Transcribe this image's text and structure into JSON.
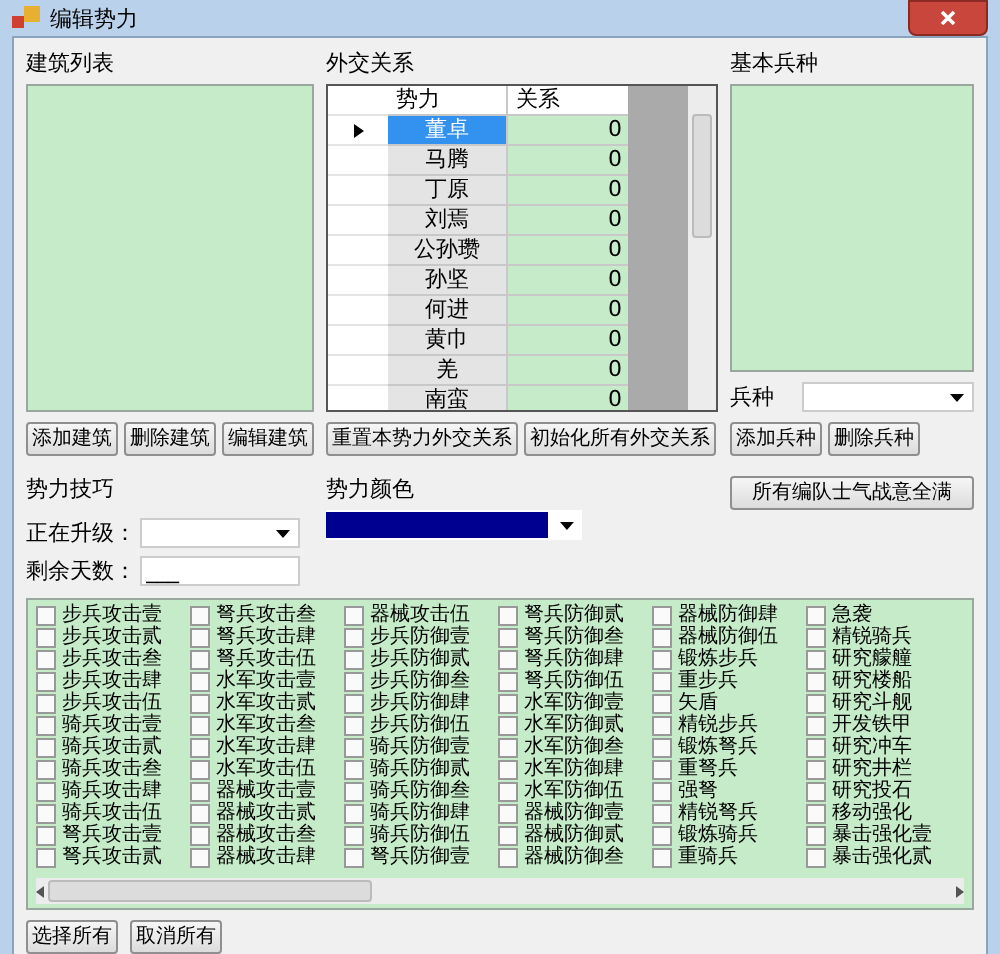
{
  "window": {
    "title": "编辑势力"
  },
  "buildings": {
    "label": "建筑列表",
    "buttons": [
      "添加建筑",
      "删除建筑",
      "编辑建筑"
    ]
  },
  "diplomacy": {
    "label": "外交关系",
    "columns": [
      "势力",
      "关系"
    ],
    "rows": [
      {
        "faction": "董卓",
        "relation": "0",
        "selected": true
      },
      {
        "faction": "马腾",
        "relation": "0",
        "selected": false
      },
      {
        "faction": "丁原",
        "relation": "0",
        "selected": false
      },
      {
        "faction": "刘焉",
        "relation": "0",
        "selected": false
      },
      {
        "faction": "公孙瓒",
        "relation": "0",
        "selected": false
      },
      {
        "faction": "孙坚",
        "relation": "0",
        "selected": false
      },
      {
        "faction": "何进",
        "relation": "0",
        "selected": false
      },
      {
        "faction": "黄巾",
        "relation": "0",
        "selected": false
      },
      {
        "faction": "羌",
        "relation": "0",
        "selected": false
      },
      {
        "faction": "南蛮",
        "relation": "0",
        "selected": false
      }
    ],
    "buttons": [
      "重置本势力外交关系",
      "初始化所有外交关系"
    ]
  },
  "troops": {
    "label": "基本兵种",
    "type_label": "兵种",
    "buttons": [
      "添加兵种",
      "删除兵种"
    ]
  },
  "skills": {
    "label": "势力技巧",
    "upgrading_label": "正在升级：",
    "days_label": "剩余天数：",
    "days_value": "___"
  },
  "faction_color": {
    "label": "势力颜色",
    "color": "#000090"
  },
  "morale_button": "所有编队士气战意全满",
  "techs": [
    {
      "label": "步兵攻击壹",
      "checked": false
    },
    {
      "label": "步兵攻击贰",
      "checked": false
    },
    {
      "label": "步兵攻击叁",
      "checked": false
    },
    {
      "label": "步兵攻击肆",
      "checked": false
    },
    {
      "label": "步兵攻击伍",
      "checked": false
    },
    {
      "label": "骑兵攻击壹",
      "checked": false
    },
    {
      "label": "骑兵攻击贰",
      "checked": false
    },
    {
      "label": "骑兵攻击叁",
      "checked": false
    },
    {
      "label": "骑兵攻击肆",
      "checked": false
    },
    {
      "label": "骑兵攻击伍",
      "checked": false
    },
    {
      "label": "弩兵攻击壹",
      "checked": false
    },
    {
      "label": "弩兵攻击贰",
      "checked": false
    },
    {
      "label": "弩兵攻击叁",
      "checked": false
    },
    {
      "label": "弩兵攻击肆",
      "checked": false
    },
    {
      "label": "弩兵攻击伍",
      "checked": false
    },
    {
      "label": "水军攻击壹",
      "checked": false
    },
    {
      "label": "水军攻击贰",
      "checked": false
    },
    {
      "label": "水军攻击叁",
      "checked": false
    },
    {
      "label": "水军攻击肆",
      "checked": false
    },
    {
      "label": "水军攻击伍",
      "checked": false
    },
    {
      "label": "器械攻击壹",
      "checked": false
    },
    {
      "label": "器械攻击贰",
      "checked": false
    },
    {
      "label": "器械攻击叁",
      "checked": false
    },
    {
      "label": "器械攻击肆",
      "checked": false
    },
    {
      "label": "器械攻击伍",
      "checked": false
    },
    {
      "label": "步兵防御壹",
      "checked": false
    },
    {
      "label": "步兵防御贰",
      "checked": false
    },
    {
      "label": "步兵防御叁",
      "checked": false
    },
    {
      "label": "步兵防御肆",
      "checked": false
    },
    {
      "label": "步兵防御伍",
      "checked": false
    },
    {
      "label": "骑兵防御壹",
      "checked": false
    },
    {
      "label": "骑兵防御贰",
      "checked": false
    },
    {
      "label": "骑兵防御叁",
      "checked": false
    },
    {
      "label": "骑兵防御肆",
      "checked": false
    },
    {
      "label": "骑兵防御伍",
      "checked": false
    },
    {
      "label": "弩兵防御壹",
      "checked": false
    },
    {
      "label": "弩兵防御贰",
      "checked": false
    },
    {
      "label": "弩兵防御叁",
      "checked": false
    },
    {
      "label": "弩兵防御肆",
      "checked": false
    },
    {
      "label": "弩兵防御伍",
      "checked": false
    },
    {
      "label": "水军防御壹",
      "checked": false
    },
    {
      "label": "水军防御贰",
      "checked": false
    },
    {
      "label": "水军防御叁",
      "checked": false
    },
    {
      "label": "水军防御肆",
      "checked": false
    },
    {
      "label": "水军防御伍",
      "checked": false
    },
    {
      "label": "器械防御壹",
      "checked": false
    },
    {
      "label": "器械防御贰",
      "checked": false
    },
    {
      "label": "器械防御叁",
      "checked": false
    },
    {
      "label": "器械防御肆",
      "checked": false
    },
    {
      "label": "器械防御伍",
      "checked": false
    },
    {
      "label": "锻炼步兵",
      "checked": false
    },
    {
      "label": "重步兵",
      "checked": false
    },
    {
      "label": "矢盾",
      "checked": false
    },
    {
      "label": "精锐步兵",
      "checked": false
    },
    {
      "label": "锻炼弩兵",
      "checked": false
    },
    {
      "label": "重弩兵",
      "checked": false
    },
    {
      "label": "强弩",
      "checked": false
    },
    {
      "label": "精锐弩兵",
      "checked": false
    },
    {
      "label": "锻炼骑兵",
      "checked": false
    },
    {
      "label": "重骑兵",
      "checked": false
    },
    {
      "label": "急袭",
      "checked": false
    },
    {
      "label": "精锐骑兵",
      "checked": false
    },
    {
      "label": "研究艨艟",
      "checked": false
    },
    {
      "label": "研究楼船",
      "checked": false
    },
    {
      "label": "研究斗舰",
      "checked": false
    },
    {
      "label": "开发铁甲",
      "checked": false
    },
    {
      "label": "研究冲车",
      "checked": false
    },
    {
      "label": "研究井栏",
      "checked": false
    },
    {
      "label": "研究投石",
      "checked": false
    },
    {
      "label": "移动强化",
      "checked": false
    },
    {
      "label": "暴击强化壹",
      "checked": false
    },
    {
      "label": "暴击强化贰",
      "checked": false
    }
  ],
  "bottom_buttons": [
    "选择所有",
    "取消所有"
  ]
}
